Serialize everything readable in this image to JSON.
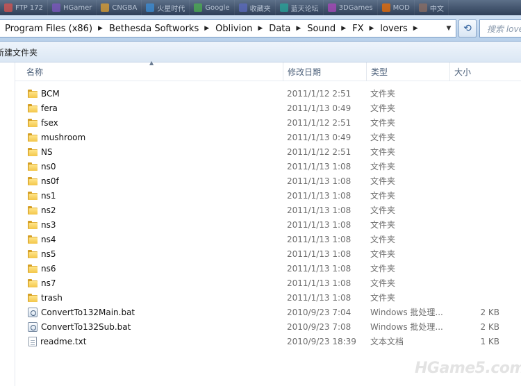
{
  "taskbar": {
    "items": [
      {
        "label": "FTP 172",
        "color": "#d9534f"
      },
      {
        "label": "HGamer",
        "color": "#7e57c2"
      },
      {
        "label": "CNGBA",
        "color": "#e0a030"
      },
      {
        "label": "火星时代",
        "color": "#3b8fd9"
      },
      {
        "label": "Google",
        "color": "#4caf50"
      },
      {
        "label": "收藏夹",
        "color": "#5c6bc0"
      },
      {
        "label": "蓝天论坛",
        "color": "#26a69a"
      },
      {
        "label": "3DGames",
        "color": "#ab47bc"
      },
      {
        "label": "MOD",
        "color": "#ef6c00"
      },
      {
        "label": "中文",
        "color": "#8d6e63"
      }
    ]
  },
  "address_bar": {
    "crumbs": [
      "Program Files (x86)",
      "Bethesda Softworks",
      "Oblivion",
      "Data",
      "Sound",
      "FX",
      "lovers"
    ],
    "search_placeholder": "搜索 lovers"
  },
  "toolbar": {
    "new_folder_label": "新建文件夹"
  },
  "columns": {
    "name": "名称",
    "date": "修改日期",
    "type": "类型",
    "size": "大小"
  },
  "files": [
    {
      "name": "BCM",
      "date": "2011/1/12 2:51",
      "type": "文件夹",
      "size": "",
      "icon": "folder-icon"
    },
    {
      "name": "fera",
      "date": "2011/1/13 0:49",
      "type": "文件夹",
      "size": "",
      "icon": "folder-icon"
    },
    {
      "name": "fsex",
      "date": "2011/1/12 2:51",
      "type": "文件夹",
      "size": "",
      "icon": "folder-icon"
    },
    {
      "name": "mushroom",
      "date": "2011/1/13 0:49",
      "type": "文件夹",
      "size": "",
      "icon": "folder-icon"
    },
    {
      "name": "NS",
      "date": "2011/1/12 2:51",
      "type": "文件夹",
      "size": "",
      "icon": "folder-icon"
    },
    {
      "name": "ns0",
      "date": "2011/1/13 1:08",
      "type": "文件夹",
      "size": "",
      "icon": "folder-icon"
    },
    {
      "name": "ns0f",
      "date": "2011/1/13 1:08",
      "type": "文件夹",
      "size": "",
      "icon": "folder-icon"
    },
    {
      "name": "ns1",
      "date": "2011/1/13 1:08",
      "type": "文件夹",
      "size": "",
      "icon": "folder-icon"
    },
    {
      "name": "ns2",
      "date": "2011/1/13 1:08",
      "type": "文件夹",
      "size": "",
      "icon": "folder-icon"
    },
    {
      "name": "ns3",
      "date": "2011/1/13 1:08",
      "type": "文件夹",
      "size": "",
      "icon": "folder-icon"
    },
    {
      "name": "ns4",
      "date": "2011/1/13 1:08",
      "type": "文件夹",
      "size": "",
      "icon": "folder-icon"
    },
    {
      "name": "ns5",
      "date": "2011/1/13 1:08",
      "type": "文件夹",
      "size": "",
      "icon": "folder-icon"
    },
    {
      "name": "ns6",
      "date": "2011/1/13 1:08",
      "type": "文件夹",
      "size": "",
      "icon": "folder-icon"
    },
    {
      "name": "ns7",
      "date": "2011/1/13 1:08",
      "type": "文件夹",
      "size": "",
      "icon": "folder-icon"
    },
    {
      "name": "trash",
      "date": "2011/1/13 1:08",
      "type": "文件夹",
      "size": "",
      "icon": "folder-icon"
    },
    {
      "name": "ConvertTo132Main.bat",
      "date": "2010/9/23 7:04",
      "type": "Windows 批处理...",
      "size": "2 KB",
      "icon": "batch-file-icon"
    },
    {
      "name": "ConvertTo132Sub.bat",
      "date": "2010/9/23 7:08",
      "type": "Windows 批处理...",
      "size": "2 KB",
      "icon": "batch-file-icon"
    },
    {
      "name": "readme.txt",
      "date": "2010/9/23 18:39",
      "type": "文本文档",
      "size": "1 KB",
      "icon": "text-file-icon"
    }
  ],
  "watermark": "HGame5.com"
}
